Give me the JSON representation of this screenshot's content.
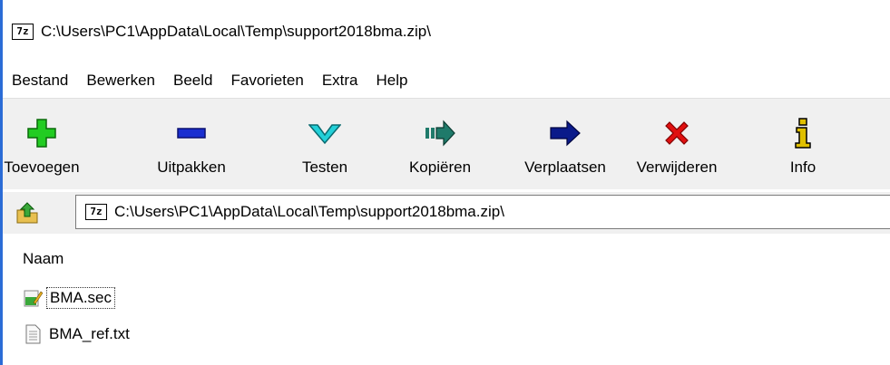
{
  "window": {
    "title": "C:\\Users\\PC1\\AppData\\Local\\Temp\\support2018bma.zip\\",
    "app_icon_text": "7z"
  },
  "menu": [
    {
      "label": "Bestand"
    },
    {
      "label": "Bewerken"
    },
    {
      "label": "Beeld"
    },
    {
      "label": "Favorieten"
    },
    {
      "label": "Extra"
    },
    {
      "label": "Help"
    }
  ],
  "toolbar": [
    {
      "label": "Toevoegen",
      "icon": "plus-icon",
      "color": "#22cc22"
    },
    {
      "label": "Uitpakken",
      "icon": "minus-icon",
      "color": "#1a2fd0"
    },
    {
      "label": "Testen",
      "icon": "checkmark-icon",
      "color": "#22d0d8"
    },
    {
      "label": "Kopiëren",
      "icon": "copy-arrow-icon",
      "color": "#1f7a6a"
    },
    {
      "label": "Verplaatsen",
      "icon": "move-arrow-icon",
      "color": "#0a1a8a"
    },
    {
      "label": "Verwijderen",
      "icon": "delete-x-icon",
      "color": "#e01010"
    },
    {
      "label": "Info",
      "icon": "info-icon",
      "color": "#e0c000"
    }
  ],
  "addressbar": {
    "path": "C:\\Users\\PC1\\AppData\\Local\\Temp\\support2018bma.zip\\",
    "icon_text": "7z"
  },
  "filelist": {
    "column_name": "Naam",
    "files": [
      {
        "name": "BMA.sec",
        "icon": "sec-file-icon",
        "focused": true
      },
      {
        "name": "BMA_ref.txt",
        "icon": "text-file-icon",
        "focused": false
      }
    ]
  }
}
